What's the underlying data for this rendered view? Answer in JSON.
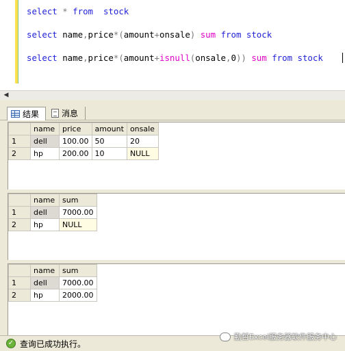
{
  "editor": {
    "lines": [
      [
        {
          "t": "select",
          "c": "kw"
        },
        {
          "t": " ",
          "c": "pl"
        },
        {
          "t": "*",
          "c": "op"
        },
        {
          "t": " ",
          "c": "pl"
        },
        {
          "t": "from",
          "c": "kw"
        },
        {
          "t": "  ",
          "c": "pl"
        },
        {
          "t": "stock",
          "c": "kw"
        }
      ],
      [
        {
          "t": "select",
          "c": "kw"
        },
        {
          "t": " name",
          "c": "pl"
        },
        {
          "t": ",",
          "c": "op"
        },
        {
          "t": "price",
          "c": "pl"
        },
        {
          "t": "*(",
          "c": "op"
        },
        {
          "t": "amount",
          "c": "pl"
        },
        {
          "t": "+",
          "c": "op"
        },
        {
          "t": "onsale",
          "c": "pl"
        },
        {
          "t": ")",
          "c": "op"
        },
        {
          "t": " ",
          "c": "pl"
        },
        {
          "t": "sum",
          "c": "fn"
        },
        {
          "t": " ",
          "c": "pl"
        },
        {
          "t": "from",
          "c": "kw"
        },
        {
          "t": " stock",
          "c": "kw"
        }
      ],
      [
        {
          "t": "select",
          "c": "kw"
        },
        {
          "t": " name",
          "c": "pl"
        },
        {
          "t": ",",
          "c": "op"
        },
        {
          "t": "price",
          "c": "pl"
        },
        {
          "t": "*(",
          "c": "op"
        },
        {
          "t": "amount",
          "c": "pl"
        },
        {
          "t": "+",
          "c": "op"
        },
        {
          "t": "isnull",
          "c": "fn"
        },
        {
          "t": "(",
          "c": "op"
        },
        {
          "t": "onsale",
          "c": "pl"
        },
        {
          "t": ",",
          "c": "op"
        },
        {
          "t": "0",
          "c": "pl"
        },
        {
          "t": "))",
          "c": "op"
        },
        {
          "t": " ",
          "c": "pl"
        },
        {
          "t": "sum",
          "c": "fn"
        },
        {
          "t": " ",
          "c": "pl"
        },
        {
          "t": "from",
          "c": "kw"
        },
        {
          "t": " stock",
          "c": "kw"
        }
      ]
    ]
  },
  "tabs": {
    "results_label": "结果",
    "messages_label": "消息"
  },
  "grids": [
    {
      "columns": [
        "name",
        "price",
        "amount",
        "onsale"
      ],
      "rows": [
        {
          "num": "1",
          "cells": [
            "dell",
            "100.00",
            "50",
            "20"
          ]
        },
        {
          "num": "2",
          "cells": [
            "hp",
            "200.00",
            "10",
            "NULL"
          ]
        }
      ]
    },
    {
      "columns": [
        "name",
        "sum"
      ],
      "rows": [
        {
          "num": "1",
          "cells": [
            "dell",
            "7000.00"
          ]
        },
        {
          "num": "2",
          "cells": [
            "hp",
            "NULL"
          ]
        }
      ]
    },
    {
      "columns": [
        "name",
        "sum"
      ],
      "rows": [
        {
          "num": "1",
          "cells": [
            "dell",
            "7000.00"
          ]
        },
        {
          "num": "2",
          "cells": [
            "hp",
            "2000.00"
          ]
        }
      ]
    }
  ],
  "status": {
    "message": "查询已成功执行。",
    "icon": "check-icon"
  },
  "watermark": {
    "text": "勤哲Excel服务器软件服务中心"
  }
}
